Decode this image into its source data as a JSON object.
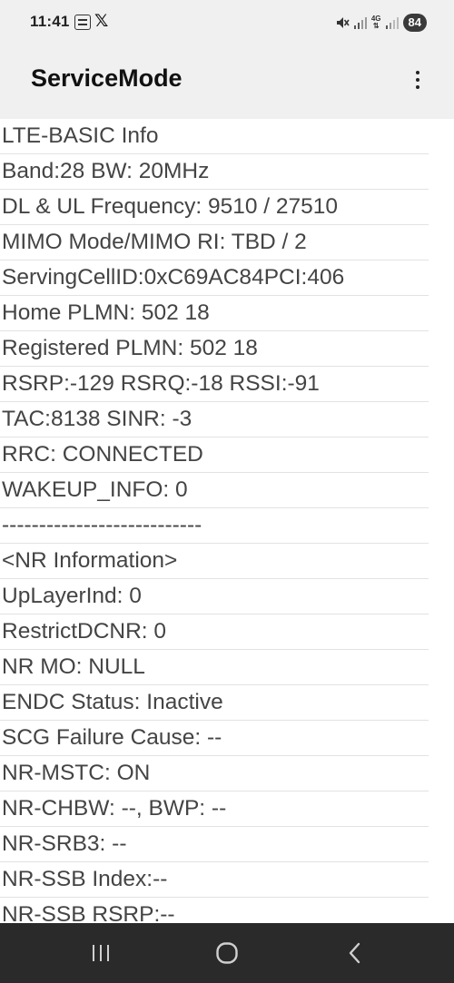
{
  "status_bar": {
    "time": "11:41",
    "notification_icons": [
      "notification-app-icon",
      "x-icon"
    ],
    "system_icons": [
      "mute-icon",
      "signal-icon",
      "4g-data-icon",
      "signal-icon"
    ],
    "network_label": "4G",
    "battery": "84"
  },
  "app_bar": {
    "title": "ServiceMode",
    "menu_icon": "more-vertical-icon"
  },
  "info_lines": [
    "LTE-BASIC Info",
    "Band:28 BW: 20MHz",
    "DL & UL Frequency: 9510 / 27510",
    "MIMO Mode/MIMO RI: TBD / 2",
    "ServingCellID:0xC69AC84PCI:406",
    "Home PLMN: 502 18",
    "Registered PLMN: 502 18",
    "RSRP:-129 RSRQ:-18 RSSI:-91",
    "TAC:8138 SINR: -3",
    "RRC: CONNECTED",
    "WAKEUP_INFO: 0",
    "---------------------------",
    "<NR Information>",
    "UpLayerInd: 0",
    "RestrictDCNR: 0",
    "NR MO: NULL",
    "ENDC Status: Inactive",
    "SCG Failure Cause: --",
    "NR-MSTC: ON",
    "NR-CHBW: --, BWP: --",
    "NR-SRB3: --",
    "NR-SSB Index:--",
    "NR-SSB RSRP:--"
  ],
  "nav_bar": {
    "buttons": [
      "recents-icon",
      "home-icon",
      "back-icon"
    ]
  },
  "colors": {
    "header_bg": "#f0f0f0",
    "content_bg": "#ffffff",
    "text": "#444444",
    "nav_bg": "#2a2a2a"
  }
}
